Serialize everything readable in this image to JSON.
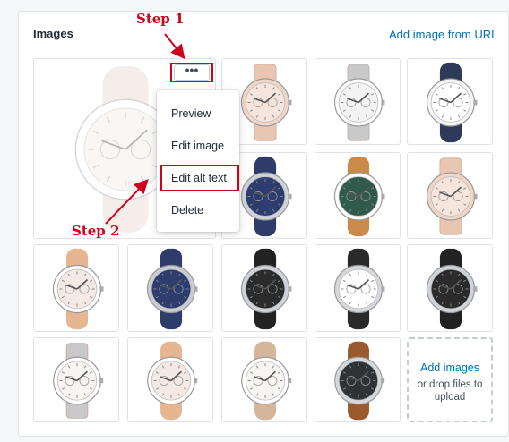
{
  "section": {
    "title": "Images",
    "add_from_url": "Add image from URL"
  },
  "annotations": {
    "step1": "Step 1",
    "step2": "Step 2",
    "accent": "#d0021b"
  },
  "more_button": {
    "label": "•••",
    "icon": "more-horizontal-icon"
  },
  "menu": {
    "items": [
      "Preview",
      "Edit image",
      "Edit alt text",
      "Delete"
    ],
    "highlighted": "Edit alt text"
  },
  "upload": {
    "link": "Add images",
    "hint": "or drop files to upload"
  },
  "images": [
    {
      "strap": "#e8d8cf",
      "face": "#ffffff",
      "dial": "#f2ece6",
      "type": "leather"
    },
    {
      "strap": "#e9c6b3",
      "face": "#f1d6c8",
      "dial": "#f6e5dc",
      "type": "metal"
    },
    {
      "strap": "#c9c9c9",
      "face": "#ffffff",
      "dial": "#f3f3f3",
      "type": "bangle"
    },
    {
      "strap": "#2f3a5a",
      "face": "#f5f5f5",
      "dial": "#ffffff",
      "type": "leather"
    },
    {
      "strap": "#2e3c6b",
      "face": "#cfd3da",
      "dial": "#2d3e6e",
      "type": "leather"
    },
    {
      "strap": "#c98a4a",
      "face": "#ffffff",
      "dial": "#2f5a4c",
      "type": "leather"
    },
    {
      "strap": "#e9c6b3",
      "face": "#f1d6c8",
      "dial": "#f6e5dc",
      "type": "metal"
    },
    {
      "strap": "#e6b692",
      "face": "#ffffff",
      "dial": "#f4e9e4",
      "type": "leather"
    },
    {
      "strap": "#2e3c6b",
      "face": "#c9ccd3",
      "dial": "#2d3e6e",
      "type": "leather"
    },
    {
      "strap": "#222222",
      "face": "#cfd3da",
      "dial": "#2b2b2b",
      "type": "leather"
    },
    {
      "strap": "#2a2a2a",
      "face": "#d5d8dd",
      "dial": "#ffffff",
      "type": "leather"
    },
    {
      "strap": "#222222",
      "face": "#cfd3da",
      "dial": "#2b2b2b",
      "type": "leather"
    },
    {
      "strap": "#c9c9c9",
      "face": "#ffffff",
      "dial": "#f8f4f1",
      "type": "bangle"
    },
    {
      "strap": "#e6b692",
      "face": "#ffffff",
      "dial": "#f4e9e4",
      "type": "leather"
    },
    {
      "strap": "#d6b69a",
      "face": "#ffffff",
      "dial": "#f7f5f2",
      "type": "leather"
    },
    {
      "strap": "#9a5a2e",
      "face": "#d5d8dd",
      "dial": "#2f3236",
      "type": "leather"
    }
  ]
}
